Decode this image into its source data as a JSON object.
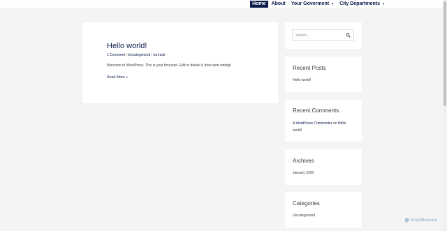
{
  "nav": {
    "items": [
      {
        "label": "Home",
        "active": true
      },
      {
        "label": "About"
      },
      {
        "label": "Your Goverment",
        "dropdown": true
      },
      {
        "label": "City Departments",
        "dropdown": true
      }
    ],
    "caret": "▼"
  },
  "post": {
    "title": "Hello world!",
    "comments": "1 Comment",
    "separator": " / ",
    "category": "Uncategorized",
    "author": "icinnzdr",
    "excerpt": "Welcome to WordPress. This is your first post. Edit or delete it, then start writing!",
    "read_more": "Read More »"
  },
  "sidebar": {
    "search": {
      "placeholder": "Search..."
    },
    "recent_posts": {
      "title": "Recent Posts",
      "items": [
        "Hello world!"
      ]
    },
    "recent_comments": {
      "title": "Recent Comments",
      "author": "A WordPress Commenter",
      "on": " on ",
      "post_part1": "Hello",
      "post_part2": "world!"
    },
    "archives": {
      "title": "Archives",
      "items": [
        "January 2020"
      ]
    },
    "categories": {
      "title": "Categories",
      "items": [
        "Uncategorized"
      ]
    }
  },
  "watermark": {
    "text": "ScanMalware"
  },
  "colors": {
    "accent": "#0a1a4a",
    "background": "#f4f4f4",
    "card": "#ffffff"
  }
}
